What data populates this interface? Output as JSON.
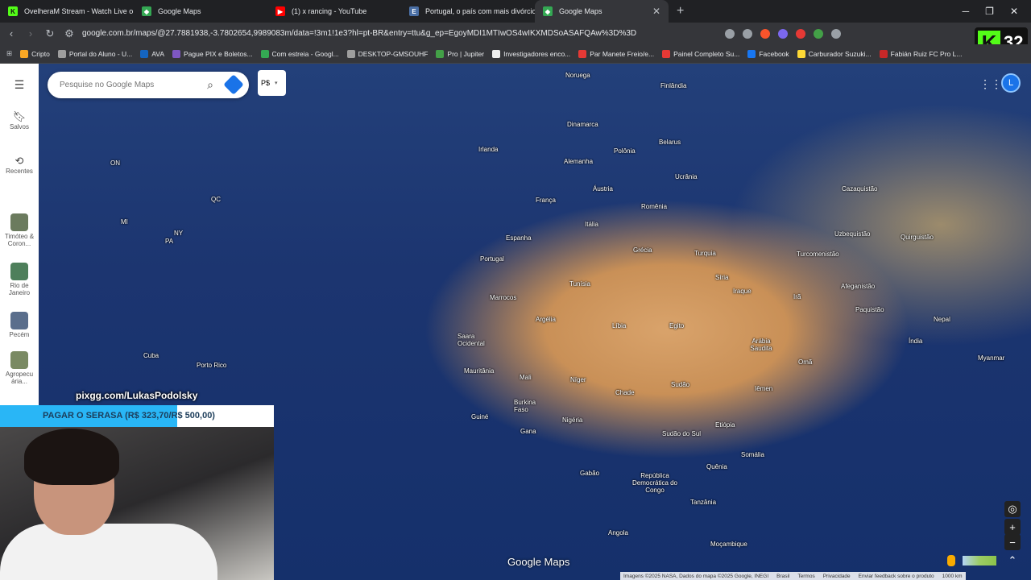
{
  "browser": {
    "tabs": [
      {
        "title": "OvelheraM Stream - Watch Live o",
        "icon": "kick-icon",
        "color": "#53fc18"
      },
      {
        "title": "Google Maps",
        "icon": "maps-icon",
        "color": "#34a853"
      },
      {
        "title": "(1) x rancing - YouTube",
        "icon": "youtube-icon",
        "color": "#ff0000"
      },
      {
        "title": "Portugal, o país com mais divórcios c",
        "icon": "e-icon",
        "color": "#4a6fa5"
      },
      {
        "title": "Google Maps",
        "icon": "maps-icon",
        "color": "#34a853"
      }
    ],
    "url": "google.com.br/maps/@27.7881938,-3.7802654,9989083m/data=!3m1!1e3?hl=pt-BR&entry=ttu&g_ep=EgoyMDI1MTIwOS4wIKXMDSoASAFQAw%3D%3D",
    "bookmarks": [
      "Cripto",
      "Portal do Aluno - U...",
      "AVA",
      "Pague PIX e Boletos...",
      "Com estreia - Googl...",
      "DESKTOP-GMSOUHF",
      "Pro | Jupiter",
      "Investigadores enco...",
      "Par Manete Freio/e...",
      "Painel Completo Su...",
      "Facebook",
      "Carburador Suzuki...",
      "Fabián Ruiz FC Pro L..."
    ],
    "kick_count": "32"
  },
  "maps": {
    "search_placeholder": "Pesquise no Google Maps",
    "chip_label": "P$",
    "sidebar": [
      {
        "label": "Salvos"
      },
      {
        "label": "Recentes"
      },
      {
        "label": "Timóteo & Coron..."
      },
      {
        "label": "Rio de Janeiro"
      },
      {
        "label": "Pecém"
      },
      {
        "label": "Agropecu ária..."
      }
    ],
    "avatar_letter": "L",
    "logo": "Google Maps",
    "footer": [
      "Imagens ©2025 NASA, Dados do mapa ©2025 Google, INEGI",
      "Brasil",
      "Termos",
      "Privacidade",
      "Enviar feedback sobre o produto",
      "1000 km"
    ],
    "labels": [
      "Noruega",
      "Dinamarca",
      "Irlanda",
      "Polônia",
      "Belarus",
      "Alemanha",
      "Ucrânia",
      "França",
      "Áustria",
      "Romênia",
      "Itália",
      "Espanha",
      "Portugal",
      "Grécia",
      "Turquia",
      "Tunísia",
      "Marrocos",
      "Síria",
      "Iraque",
      "Argélia",
      "Líbia",
      "Egito",
      "Arábia Saudita",
      "Saara Ocidental",
      "Mauritânia",
      "Mali",
      "Níger",
      "Chade",
      "Sudão",
      "Omã",
      "Iêmen",
      "Burkina Faso",
      "Guiné",
      "Gana",
      "Nigéria",
      "Etiópia",
      "Sudão do Sul",
      "Somália",
      "Quênia",
      "Gabão",
      "República Democrática do Congo",
      "Tanzânia",
      "Angola",
      "Moçambique",
      "Cazaquistão",
      "Uzbequistão",
      "Quirguistão",
      "Turcomenistão",
      "Afeganistão",
      "Irã",
      "Paquistão",
      "Nepal",
      "Índia",
      "Myanmar",
      "Cuba",
      "Porto Rico",
      "ON",
      "QC",
      "NY",
      "PA",
      "MI",
      "Finlândia"
    ]
  },
  "stream": {
    "pix": "pixgg.com/LukasPodolsky",
    "goal_text": "PAGAR O SERASA (R$ 323,70/R$ 500,00)",
    "goal_progress": 0.6474
  }
}
